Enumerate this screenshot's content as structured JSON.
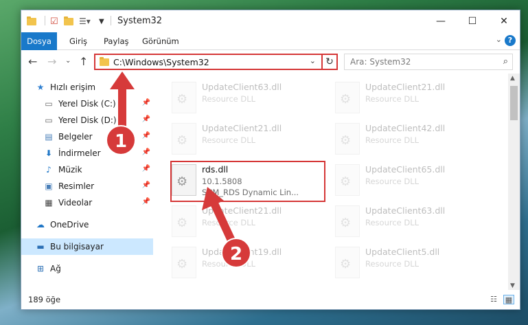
{
  "window": {
    "title": "System32"
  },
  "window_controls": {
    "minimize": "—",
    "maximize": "☐",
    "close": "✕"
  },
  "ribbon": {
    "tabs": [
      {
        "label": "Dosya"
      },
      {
        "label": "Giriş"
      },
      {
        "label": "Paylaş"
      },
      {
        "label": "Görünüm"
      }
    ]
  },
  "nav": {
    "address": "C:\\Windows\\System32",
    "search_placeholder": "Ara: System32"
  },
  "sidebar": {
    "items": [
      {
        "label": "Hızlı erişim",
        "icon": "star-icon"
      },
      {
        "label": "Yerel Disk (C:)",
        "icon": "drive-icon"
      },
      {
        "label": "Yerel Disk (D:)",
        "icon": "drive-icon"
      },
      {
        "label": "Belgeler",
        "icon": "documents-icon"
      },
      {
        "label": "İndirmeler",
        "icon": "download-icon"
      },
      {
        "label": "Müzik",
        "icon": "music-icon"
      },
      {
        "label": "Resimler",
        "icon": "pictures-icon"
      },
      {
        "label": "Videolar",
        "icon": "videos-icon"
      },
      {
        "label": "OneDrive",
        "icon": "cloud-icon"
      },
      {
        "label": "Bu bilgisayar",
        "icon": "computer-icon"
      },
      {
        "label": "Ağ",
        "icon": "network-icon"
      }
    ]
  },
  "files": [
    {
      "name": "UpdateClient63.dll",
      "line1": "Resource DLL",
      "line2": ""
    },
    {
      "name": "UpdateClient21.dll",
      "line1": "Resource DLL",
      "line2": ""
    },
    {
      "name": "UpdateClient21.dll",
      "line1": "Resource DLL",
      "line2": ""
    },
    {
      "name": "UpdateClient42.dll",
      "line1": "Resource DLL",
      "line2": ""
    },
    {
      "name": "rds.dll",
      "line1": "10.1.5808",
      "line2": "SCM_RDS Dynamic Lin..."
    },
    {
      "name": "UpdateClient65.dll",
      "line1": "Resource DLL",
      "line2": ""
    },
    {
      "name": "UpdateClient21.dll",
      "line1": "Resource DLL",
      "line2": ""
    },
    {
      "name": "UpdateClient63.dll",
      "line1": "Resource DLL",
      "line2": ""
    },
    {
      "name": "UpdateClient19.dll",
      "line1": "Resource DLL",
      "line2": ""
    },
    {
      "name": "UpdateClient5.dll",
      "line1": "Resource DLL",
      "line2": ""
    }
  ],
  "status": {
    "count": "189 öğe"
  },
  "annotations": {
    "badge1": "1",
    "badge2": "2"
  },
  "colors": {
    "accent": "#1979ca",
    "highlight": "#d53636",
    "selection": "#cce8ff"
  }
}
